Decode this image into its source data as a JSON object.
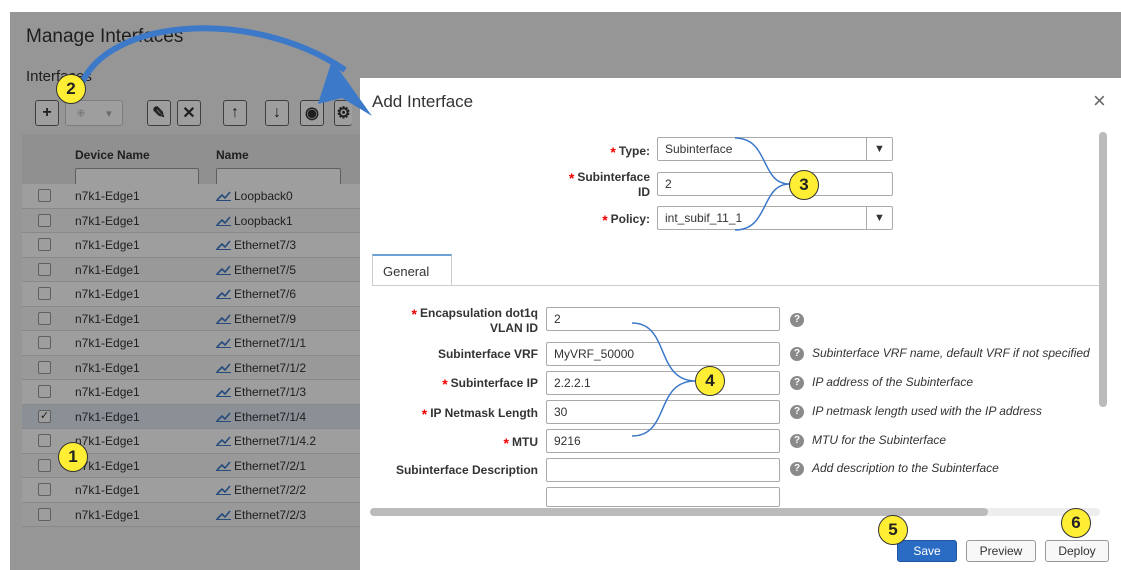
{
  "page": {
    "title": "Manage Interfaces",
    "subtitle": "Interfaces",
    "more_dots": "· ·"
  },
  "toolbar": {
    "add": "+",
    "select_glyph": "⁜",
    "select_caret": "▾",
    "edit": "✎",
    "delete": "✕",
    "up": "↑",
    "down": "↓",
    "view": "◉",
    "settings": "⚙"
  },
  "table": {
    "columns": [
      "Device Name",
      "Name"
    ],
    "rows": [
      {
        "device": "n7k1-Edge1",
        "name": "Loopback0",
        "checked": false
      },
      {
        "device": "n7k1-Edge1",
        "name": "Loopback1",
        "checked": false
      },
      {
        "device": "n7k1-Edge1",
        "name": "Ethernet7/3",
        "checked": false
      },
      {
        "device": "n7k1-Edge1",
        "name": "Ethernet7/5",
        "checked": false
      },
      {
        "device": "n7k1-Edge1",
        "name": "Ethernet7/6",
        "checked": false
      },
      {
        "device": "n7k1-Edge1",
        "name": "Ethernet7/9",
        "checked": false
      },
      {
        "device": "n7k1-Edge1",
        "name": "Ethernet7/1/1",
        "checked": false
      },
      {
        "device": "n7k1-Edge1",
        "name": "Ethernet7/1/2",
        "checked": false
      },
      {
        "device": "n7k1-Edge1",
        "name": "Ethernet7/1/3",
        "checked": false
      },
      {
        "device": "n7k1-Edge1",
        "name": "Ethernet7/1/4",
        "checked": true
      },
      {
        "device": "n7k1-Edge1",
        "name": "Ethernet7/1/4.2",
        "checked": false
      },
      {
        "device": "n7k1-Edge1",
        "name": "Ethernet7/2/1",
        "checked": false
      },
      {
        "device": "n7k1-Edge1",
        "name": "Ethernet7/2/2",
        "checked": false
      },
      {
        "device": "n7k1-Edge1",
        "name": "Ethernet7/2/3",
        "checked": false
      }
    ]
  },
  "modal": {
    "title": "Add Interface",
    "close": "×",
    "type_label": "Type:",
    "type_value": "Subinterface",
    "subif_id_label_1": "Subinterface",
    "subif_id_label_2": "ID",
    "subif_id_value": "2",
    "policy_label": "Policy:",
    "policy_value": "int_subif_11_1",
    "tab_general": "General",
    "select_arrow": "▼",
    "help_glyph": "?",
    "fields": {
      "vlan_label_1": "Encapsulation dot1q",
      "vlan_label_2": "VLAN ID",
      "vlan_value": "2",
      "vrf_label": "Subinterface VRF",
      "vrf_value": "MyVRF_50000",
      "vrf_hint": "Subinterface VRF name, default VRF if not specified",
      "ip_label": "Subinterface IP",
      "ip_value": "2.2.2.1",
      "ip_hint": "IP address of the Subinterface",
      "mask_label": "IP Netmask Length",
      "mask_value": "30",
      "mask_hint": "IP netmask length used with the IP address",
      "mtu_label": "MTU",
      "mtu_value": "9216",
      "mtu_hint": "MTU for the Subinterface",
      "desc_label": "Subinterface Description",
      "desc_value": "",
      "desc_hint": "Add description to the Subinterface"
    },
    "buttons": {
      "save": "Save",
      "preview": "Preview",
      "deploy": "Deploy"
    }
  },
  "callouts": [
    "1",
    "2",
    "3",
    "4",
    "5",
    "6"
  ],
  "colors": {
    "badge": "#ffee33",
    "arrow": "#3d79c9",
    "bracket": "#3d79c9",
    "required": "#e00000",
    "save": "#2a6cc4"
  }
}
